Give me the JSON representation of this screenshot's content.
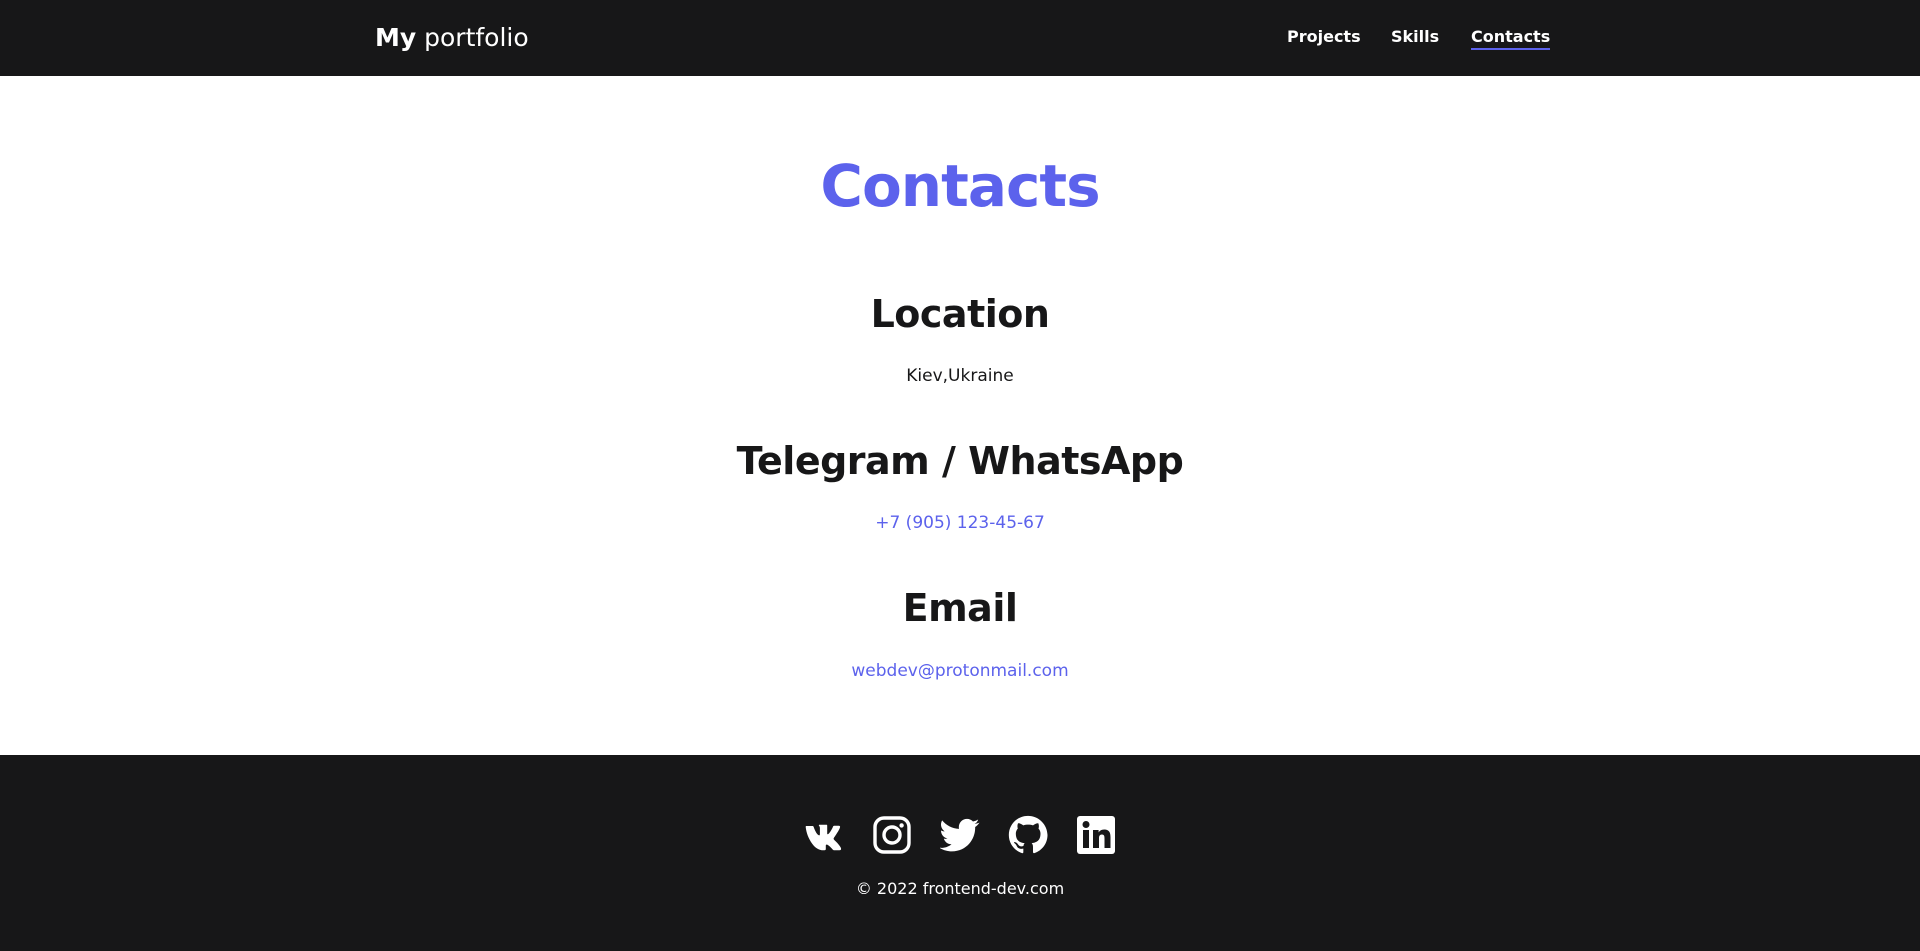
{
  "header": {
    "logo_bold": "My",
    "logo_light": "portfolio",
    "nav": [
      {
        "label": "Projects",
        "active": false
      },
      {
        "label": "Skills",
        "active": false
      },
      {
        "label": "Contacts",
        "active": true
      }
    ]
  },
  "main": {
    "title": "Contacts",
    "sections": [
      {
        "title": "Location",
        "value": "Kiev,Ukraine"
      },
      {
        "title": "Telegram / WhatsApp",
        "value": "+7 (905) 123-45-67"
      },
      {
        "title": "Email",
        "value": "webdev@protonmail.com"
      }
    ]
  },
  "footer": {
    "socials": [
      {
        "name": "vk-icon"
      },
      {
        "name": "instagram-icon"
      },
      {
        "name": "twitter-icon"
      },
      {
        "name": "github-icon"
      },
      {
        "name": "linkedin-icon"
      }
    ],
    "copyright": "© 2022 frontend-dev.com"
  },
  "colors": {
    "accent": "#5c62ec",
    "dark": "#171718",
    "background": "#ffffff"
  }
}
